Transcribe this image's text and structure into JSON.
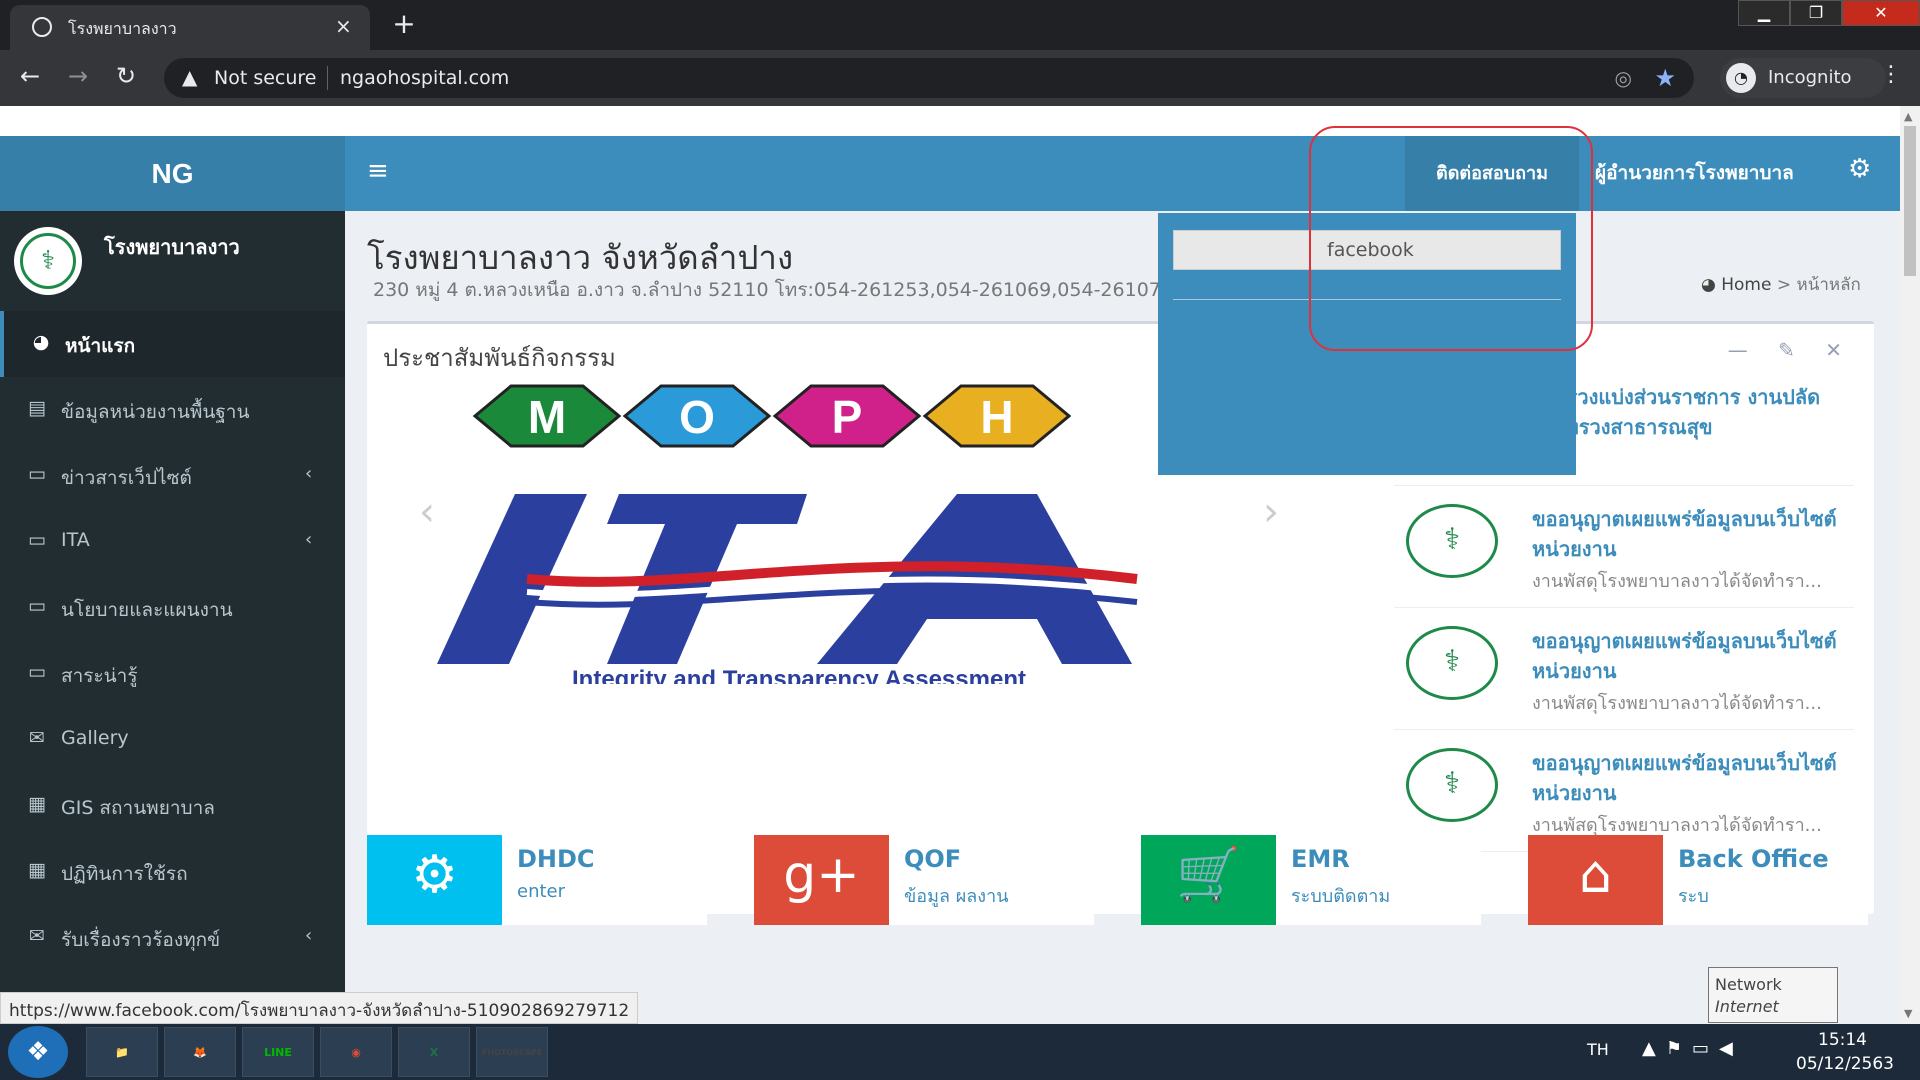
{
  "browser": {
    "tab_title": "โรงพยาบาลงาว",
    "tab_close": "×",
    "new_tab": "+",
    "security": "Not secure",
    "url": "ngaohospital.com",
    "profile": "Incognito",
    "window_controls": [
      "▁",
      "❐",
      "✕"
    ]
  },
  "site": {
    "logo": "NG",
    "hamburger": "≡",
    "nav_contact": "ติดต่อสอบถาม",
    "nav_director": "ผู้อำนวยการโรงพยาบาล",
    "user_name": "โรงพยาบาลงาว",
    "accent_color": "#3c8dbc",
    "sidebar_color": "#222d32"
  },
  "sidebar": {
    "items": [
      {
        "label": "หน้าแรก",
        "icon": "dashboard-icon",
        "glyph": "◕",
        "chevron": ""
      },
      {
        "label": "ข้อมูลหน่วยงานพื้นฐาน",
        "icon": "building-icon",
        "glyph": "▤",
        "chevron": ""
      },
      {
        "label": "ข่าวสารเว็ปไซต์",
        "icon": "laptop-icon",
        "glyph": "▭",
        "chevron": "‹"
      },
      {
        "label": "ITA",
        "icon": "laptop-icon",
        "glyph": "▭",
        "chevron": "‹"
      },
      {
        "label": "นโยบายและแผนงาน",
        "icon": "laptop-icon",
        "glyph": "▭",
        "chevron": ""
      },
      {
        "label": "สาระน่ารู้",
        "icon": "laptop-icon",
        "glyph": "▭",
        "chevron": ""
      },
      {
        "label": "Gallery",
        "icon": "envelope-icon",
        "glyph": "✉",
        "chevron": ""
      },
      {
        "label": "GIS สถานพยาบาล",
        "icon": "table-icon",
        "glyph": "▦",
        "chevron": ""
      },
      {
        "label": "ปฏิทินการใช้รถ",
        "icon": "calendar-icon",
        "glyph": "▦",
        "chevron": ""
      },
      {
        "label": "รับเรื่องราวร้องทุกข์",
        "icon": "envelope-icon",
        "glyph": "✉",
        "chevron": "‹"
      }
    ]
  },
  "header": {
    "title": "โรงพยาบาลงาว จังหวัดลำปาง",
    "address": "230 หมู่ 4 ต.หลวงเหนือ อ.งาว จ.ลำปาง 52110 โทร:054-261253,054-261069,054-261070,0",
    "breadcrumb_home": "Home",
    "breadcrumb_sep": ">",
    "breadcrumb_current": "หน้าหลัก"
  },
  "box": {
    "title": "ประชาสัมพันธ์กิจกรรม",
    "tools": "— ✎ ✕"
  },
  "carousel": {
    "moph_letters": [
      "M",
      "O",
      "P",
      "H"
    ],
    "moph_colors": [
      "#1a8a3a",
      "#2a9ad8",
      "#d0208a",
      "#e8b020"
    ],
    "ita_text": "ITA",
    "ita_subtitle": "Integrity and Transparency Assessment",
    "prev": "‹",
    "next": "›"
  },
  "news": [
    {
      "title": "ระทรวงแบ่งส่วนราชการ งานปลัดกระทรวงสาธารณสุข",
      "desc": ""
    },
    {
      "title": "ขออนุญาตเผยแพร่ข้อมูลบนเว็บไซต์หน่วยงาน",
      "desc": "งานพัสดุโรงพยาบาลงาวได้จัดทำรา..."
    },
    {
      "title": "ขออนุญาตเผยแพร่ข้อมูลบนเว็บไซต์หน่วยงาน",
      "desc": "งานพัสดุโรงพยาบาลงาวได้จัดทำรา..."
    },
    {
      "title": "ขออนุญาตเผยแพร่ข้อมูลบนเว็บไซต์หน่วยงาน",
      "desc": "งานพัสดุโรงพยาบาลงาวได้จัดทำรา..."
    }
  ],
  "infoboxes": [
    {
      "title": "DHDC",
      "sub": "enter",
      "icon": "gear-icon",
      "glyph": "⚙",
      "color": "#00c0ef"
    },
    {
      "title": "QOF",
      "sub": "ข้อมูล ผลงาน",
      "icon": "google-plus-icon",
      "glyph": "g+",
      "color": "#dd4b39"
    },
    {
      "title": "EMR",
      "sub": "ระบบติดตาม",
      "icon": "cart-icon",
      "glyph": "🛒",
      "color": "#00a65a"
    },
    {
      "title": "Back Office",
      "sub": "ระบ",
      "icon": "home-icon",
      "glyph": "⌂",
      "color": "#dd4b39"
    }
  ],
  "dropdown": {
    "item": "facebook"
  },
  "status_url": "https://www.facebook.com/โรงพยาบาลงาว-จังหวัดลำปาง-510902869279712",
  "tooltip": {
    "line1": "Network",
    "line2": "Internet access"
  },
  "taskbar": {
    "apps": [
      {
        "name": "explorer-icon",
        "label": "📁",
        "color": "#e8b830"
      },
      {
        "name": "firefox-icon",
        "label": "🦊",
        "color": "#e8602a"
      },
      {
        "name": "line-icon",
        "label": "LINE",
        "color": "#00b900"
      },
      {
        "name": "chrome-icon",
        "label": "◉",
        "color": "#dd4b39"
      },
      {
        "name": "excel-icon",
        "label": "X",
        "color": "#1f7246"
      },
      {
        "name": "photoscape-icon",
        "label": "PHOTOSCAPE",
        "color": "#444"
      }
    ],
    "lang": "TH",
    "time": "15:14",
    "date": "05/12/2563"
  }
}
